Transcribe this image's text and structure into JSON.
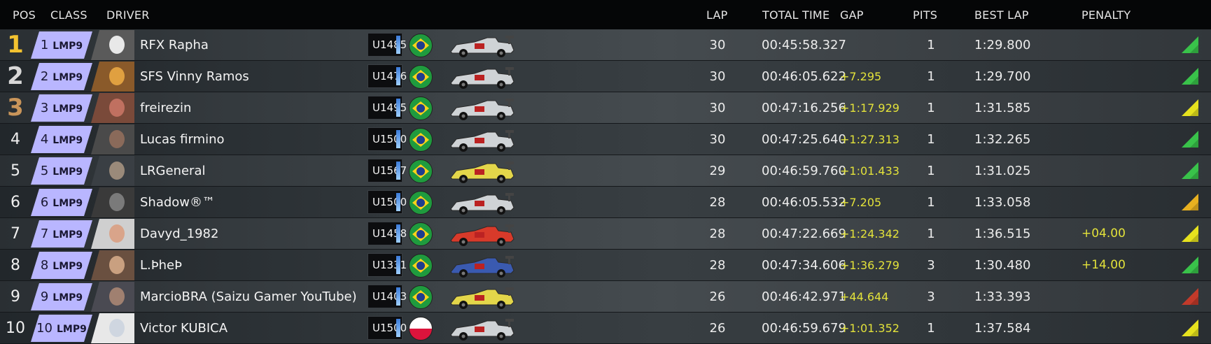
{
  "header": {
    "pos": "POS",
    "class": "CLASS",
    "driver": "DRIVER",
    "lap": "LAP",
    "total_time": "TOTAL TIME",
    "gap": "GAP",
    "pits": "PITS",
    "best_lap": "BEST LAP",
    "penalty": "PENALTY"
  },
  "colors": {
    "class_badge": "#b9b6ff",
    "gap_text": "#e3e23a",
    "gold": "#f2c230",
    "silver": "#d8d8d8",
    "bronze": "#c9955a"
  },
  "rows": [
    {
      "pos": "1",
      "class_num": "1",
      "class_name": "LMP9",
      "driver": "RFX Rapha",
      "rating": "U1485",
      "flag": "brazil-flag-icon",
      "lap": "30",
      "total": "00:45:58.327",
      "gap": "",
      "pits": "1",
      "best": "1:29.800",
      "penalty": "",
      "trend": "green"
    },
    {
      "pos": "2",
      "class_num": "2",
      "class_name": "LMP9",
      "driver": "SFS Vinny Ramos",
      "rating": "U1476",
      "flag": "brazil-flag-icon",
      "lap": "30",
      "total": "00:46:05.622",
      "gap": "+7.295",
      "pits": "1",
      "best": "1:29.700",
      "penalty": "",
      "trend": "green"
    },
    {
      "pos": "3",
      "class_num": "3",
      "class_name": "LMP9",
      "driver": "freirezin",
      "rating": "U1495",
      "flag": "brazil-flag-icon",
      "lap": "30",
      "total": "00:47:16.256",
      "gap": "+1:17.929",
      "pits": "1",
      "best": "1:31.585",
      "penalty": "",
      "trend": "yellow"
    },
    {
      "pos": "4",
      "class_num": "4",
      "class_name": "LMP9",
      "driver": "Lucas firmino",
      "rating": "U1500",
      "flag": "brazil-flag-icon",
      "lap": "30",
      "total": "00:47:25.640",
      "gap": "+1:27.313",
      "pits": "1",
      "best": "1:32.265",
      "penalty": "",
      "trend": "green"
    },
    {
      "pos": "5",
      "class_num": "5",
      "class_name": "LMP9",
      "driver": "LRGeneral",
      "rating": "U1567",
      "flag": "brazil-flag-icon",
      "lap": "29",
      "total": "00:46:59.760",
      "gap": "+1:01.433",
      "pits": "1",
      "best": "1:31.025",
      "penalty": "",
      "trend": "green"
    },
    {
      "pos": "6",
      "class_num": "6",
      "class_name": "LMP9",
      "driver": "Shadow®™",
      "rating": "U1500",
      "flag": "brazil-flag-icon",
      "lap": "28",
      "total": "00:46:05.532",
      "gap": "+7.205",
      "pits": "1",
      "best": "1:33.058",
      "penalty": "",
      "trend": "orange"
    },
    {
      "pos": "7",
      "class_num": "7",
      "class_name": "LMP9",
      "driver": "Davyd_1982",
      "rating": "U1458",
      "flag": "brazil-flag-icon",
      "lap": "28",
      "total": "00:47:22.669",
      "gap": "+1:24.342",
      "pits": "1",
      "best": "1:36.515",
      "penalty": "+04.00",
      "trend": "yellow"
    },
    {
      "pos": "8",
      "class_num": "8",
      "class_name": "LMP9",
      "driver": "L.ÞheÞ",
      "rating": "U1331",
      "flag": "brazil-flag-icon",
      "lap": "28",
      "total": "00:47:34.606",
      "gap": "+1:36.279",
      "pits": "3",
      "best": "1:30.480",
      "penalty": "+14.00",
      "trend": "green"
    },
    {
      "pos": "9",
      "class_num": "9",
      "class_name": "LMP9",
      "driver": "MarcioBRA (Saizu Gamer YouTube)",
      "rating": "U1403",
      "flag": "brazil-flag-icon",
      "lap": "26",
      "total": "00:46:42.971",
      "gap": "+44.644",
      "pits": "3",
      "best": "1:33.393",
      "penalty": "",
      "trend": "red"
    },
    {
      "pos": "10",
      "class_num": "10",
      "class_name": "LMP9",
      "driver": "Victor KUBICA",
      "rating": "U1500",
      "flag": "poland-flag-icon",
      "lap": "26",
      "total": "00:46:59.679",
      "gap": "+1:01.352",
      "pits": "1",
      "best": "1:37.584",
      "penalty": "",
      "trend": "yellow"
    }
  ]
}
